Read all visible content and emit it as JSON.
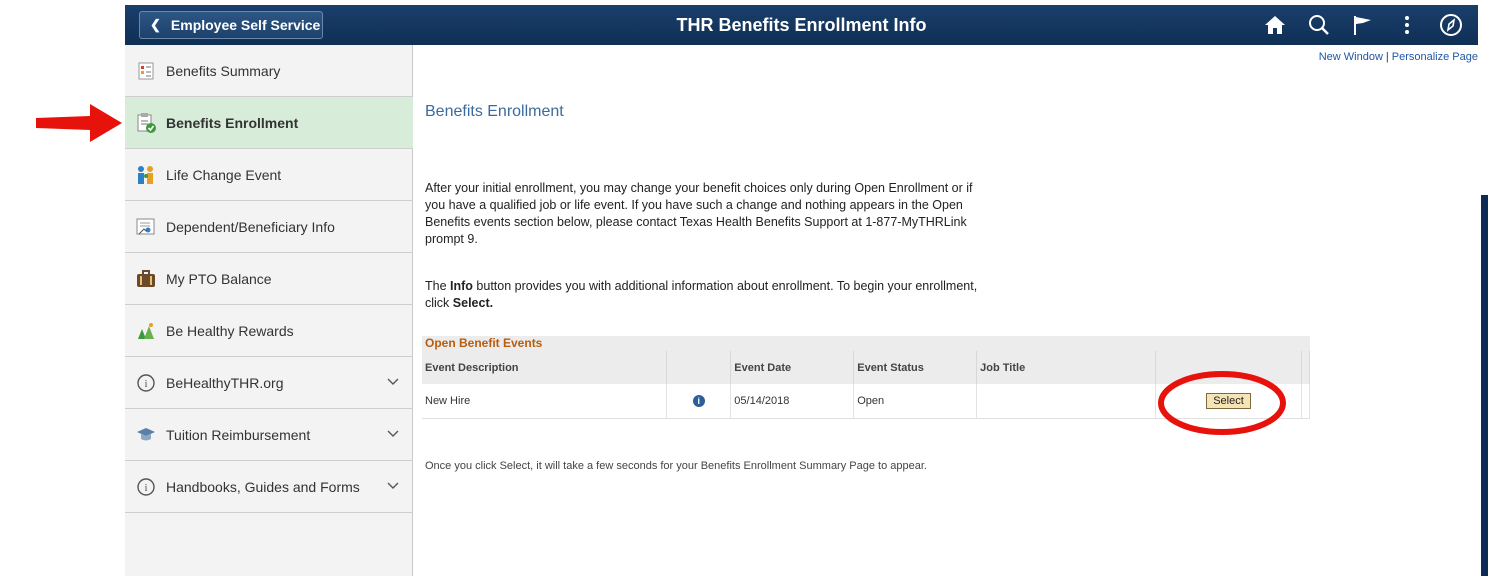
{
  "header": {
    "back_label": "Employee Self Service",
    "title": "THR Benefits Enrollment Info",
    "icons": [
      "home-icon",
      "search-icon",
      "flag-icon",
      "more-icon",
      "compass-icon"
    ]
  },
  "sidebar": {
    "items": [
      {
        "label": "Benefits Summary",
        "icon": "summary-icon",
        "selected": false,
        "expandable": false
      },
      {
        "label": "Benefits Enrollment",
        "icon": "enrollment-icon",
        "selected": true,
        "expandable": false
      },
      {
        "label": "Life Change Event",
        "icon": "family-icon",
        "selected": false,
        "expandable": false
      },
      {
        "label": "Dependent/Beneficiary Info",
        "icon": "dependent-icon",
        "selected": false,
        "expandable": false
      },
      {
        "label": "My PTO Balance",
        "icon": "pto-icon",
        "selected": false,
        "expandable": false
      },
      {
        "label": "Be Healthy Rewards",
        "icon": "rewards-icon",
        "selected": false,
        "expandable": false
      },
      {
        "label": "BeHealthyTHR.org",
        "icon": "info-circle-icon",
        "selected": false,
        "expandable": true
      },
      {
        "label": "Tuition Reimbursement",
        "icon": "graduation-cap-icon",
        "selected": false,
        "expandable": true
      },
      {
        "label": "Handbooks, Guides and Forms",
        "icon": "info-circle-icon",
        "selected": false,
        "expandable": true
      }
    ]
  },
  "main": {
    "links": {
      "new_window": "New Window",
      "separator": "|",
      "personalize": "Personalize Page"
    },
    "title": "Benefits Enrollment",
    "paragraph1": "After your initial enrollment, you may change your benefit choices only during Open Enrollment or if you have a qualified job or life event. If you have such a change and nothing appears in the Open Benefits events section below, please contact Texas Health Benefits Support at 1-877-MyTHRLink prompt 9.",
    "paragraph2": {
      "part1": "The ",
      "bold1": "Info",
      "part2": " button provides you with additional information about enrollment. To begin your enrollment, click ",
      "bold2": "Select."
    },
    "events": {
      "title": "Open Benefit Events",
      "columns": [
        "Event Description",
        "",
        "Event Date",
        "Event Status",
        "Job Title",
        "",
        ""
      ],
      "rows": [
        {
          "description": "New Hire",
          "date": "05/14/2018",
          "status": "Open",
          "job_title": "",
          "select_label": "Select",
          "info_icon": "info-icon"
        }
      ]
    },
    "note": "Once you click Select, it will take a few seconds for your Benefits Enrollment Summary Page to appear."
  },
  "annotations": {
    "arrow_color": "#e8120c",
    "oval_color": "#e8120c"
  }
}
